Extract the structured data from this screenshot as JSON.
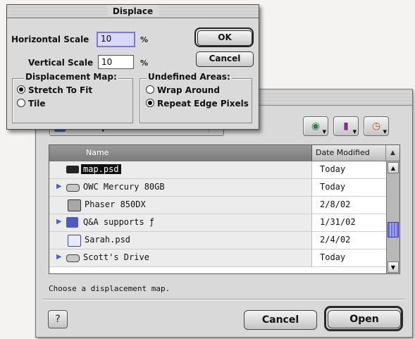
{
  "open_dialog": {
    "location": "Desktop",
    "prompt": "Choose a displacement map.",
    "columns": {
      "name": "Name",
      "date": "Date Modified"
    },
    "files": [
      {
        "name": "map.psd",
        "date": "Today",
        "selected": true,
        "expandable": false,
        "icon": "photoshop-file-icon"
      },
      {
        "name": "OWC Mercury 80GB",
        "date": "Today",
        "selected": false,
        "expandable": true,
        "icon": "hard-drive-icon"
      },
      {
        "name": "Phaser 850DX",
        "date": "2/8/02",
        "selected": false,
        "expandable": false,
        "icon": "printer-icon"
      },
      {
        "name": "Q&A supports ƒ",
        "date": "1/31/02",
        "selected": false,
        "expandable": true,
        "icon": "folder-icon"
      },
      {
        "name": "Sarah.psd",
        "date": "2/4/02",
        "selected": false,
        "expandable": false,
        "icon": "document-icon"
      },
      {
        "name": "Scott's Drive",
        "date": "Today",
        "selected": false,
        "expandable": true,
        "icon": "hard-drive-icon"
      }
    ],
    "cancel_label": "Cancel",
    "open_label": "Open",
    "help_icon": "?"
  },
  "displace": {
    "title": "Displace",
    "horizontal_label": "Horizontal Scale",
    "horizontal_value": "10",
    "vertical_label": "Vertical Scale",
    "vertical_value": "10",
    "percent_symbol": "%",
    "ok_label": "OK",
    "cancel_label": "Cancel",
    "map_group": {
      "title": "Displacement Map:",
      "options": [
        "Stretch To Fit",
        "Tile"
      ],
      "selected": "Stretch To Fit"
    },
    "undefined_group": {
      "title": "Undefined Areas:",
      "options": [
        "Wrap Around",
        "Repeat Edge Pixels"
      ],
      "selected": "Repeat Edge Pixels"
    }
  },
  "colors": {
    "selection_fill": "#d9d7fa",
    "scroll_thumb": "#6f73d9",
    "header_dark": "#7b7b7b"
  }
}
